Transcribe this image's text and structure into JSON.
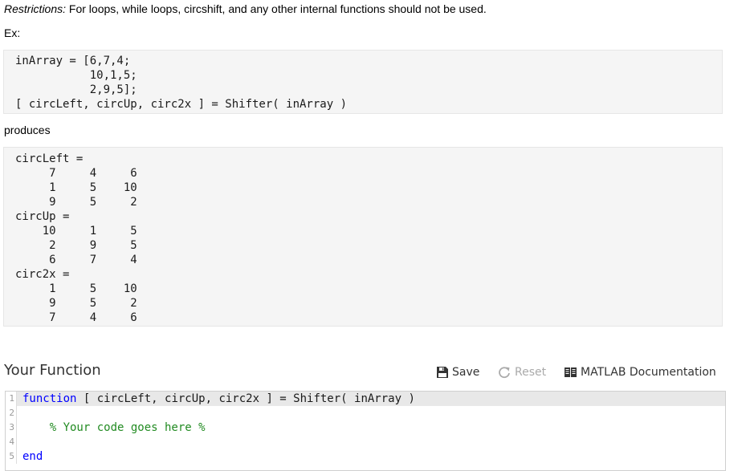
{
  "restrictions": {
    "label": "Restrictions:",
    "text": " For loops, while loops, circshift, and any other internal functions should not be used."
  },
  "example_label": "Ex:",
  "example_code": "inArray = [6,7,4;\n           10,1,5;\n           2,9,5];\n[ circLeft, circUp, circ2x ] = Shifter( inArray )",
  "produces_label": "produces",
  "output_code": "circLeft =\n     7     4     6\n     1     5    10\n     9     5     2\ncircUp =\n    10     1     5\n     2     9     5\n     6     7     4\ncirc2x =\n     1     5    10\n     9     5     2\n     7     4     6",
  "section_title": "Your Function",
  "toolbar": {
    "save_label": "Save",
    "reset_label": "Reset",
    "docs_label": "MATLAB Documentation"
  },
  "editor": {
    "line_numbers": [
      "1",
      "2",
      "3",
      "4",
      "5"
    ],
    "line1_keyword": "function",
    "line1_rest": " [ circLeft, circUp, circ2x ] = Shifter( inArray )",
    "line3_comment": "    % Your code goes here %",
    "line5_keyword": "end"
  },
  "colors": {
    "keyword": "#0000ff",
    "comment": "#228b22",
    "code_background": "#f5f5f5"
  }
}
